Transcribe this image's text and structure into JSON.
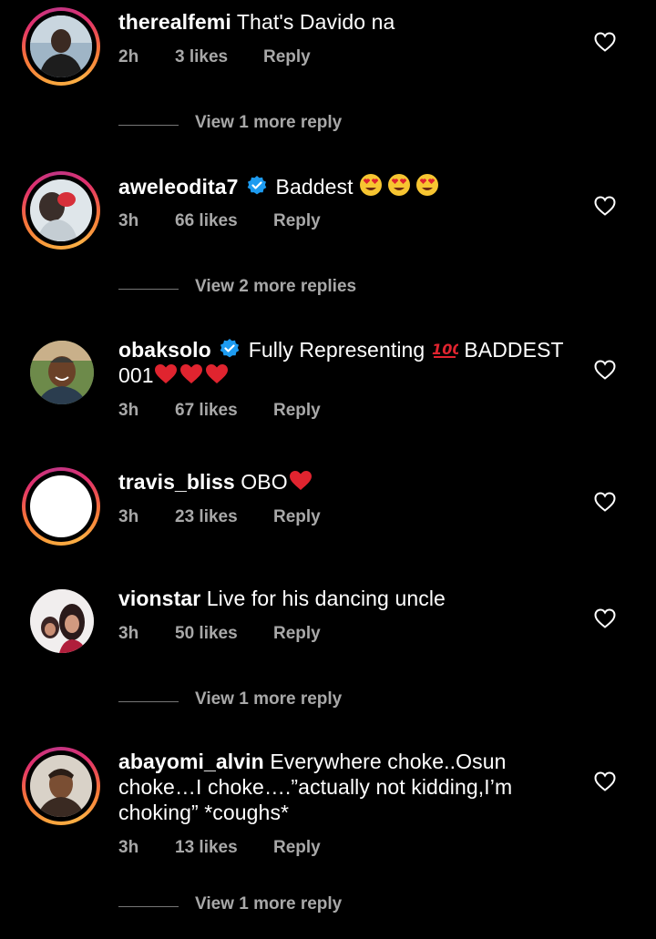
{
  "comments": [
    {
      "username": "therealfemi",
      "text": "That's Davido na",
      "time": "2h",
      "likes": "3 likes",
      "reply": "Reply",
      "view_more": "View 1 more reply"
    },
    {
      "username": "aweleodita7",
      "verified": true,
      "text": "Baddest",
      "emoji": "heart-eyes x3",
      "time": "3h",
      "likes": "66 likes",
      "reply": "Reply",
      "view_more": "View 2 more replies"
    },
    {
      "username": "obaksolo",
      "verified": true,
      "text_a": "Fully Representing",
      "text_b": "BADDEST",
      "text_c": "001",
      "time": "3h",
      "likes": "67 likes",
      "reply": "Reply"
    },
    {
      "username": "travis_bliss",
      "text": "OBO",
      "time": "3h",
      "likes": "23 likes",
      "reply": "Reply"
    },
    {
      "username": "vionstar",
      "text": "Live for his dancing uncle",
      "time": "3h",
      "likes": "50 likes",
      "reply": "Reply",
      "view_more": "View 1 more reply"
    },
    {
      "username": "abayomi_alvin",
      "text_line1": "Everywhere choke..Osun",
      "text_line2": "choke…I choke….”actually not kidding,I’m",
      "text_line3": "choking” *coughs*",
      "time": "3h",
      "likes": "13 likes",
      "reply": "Reply",
      "view_more": "View 1 more reply"
    }
  ],
  "colors": {
    "background": "#000000",
    "text": "#ffffff",
    "secondary": "#a8a8a8",
    "verified": "#1d9bf0",
    "heart_red": "#e0242f"
  }
}
